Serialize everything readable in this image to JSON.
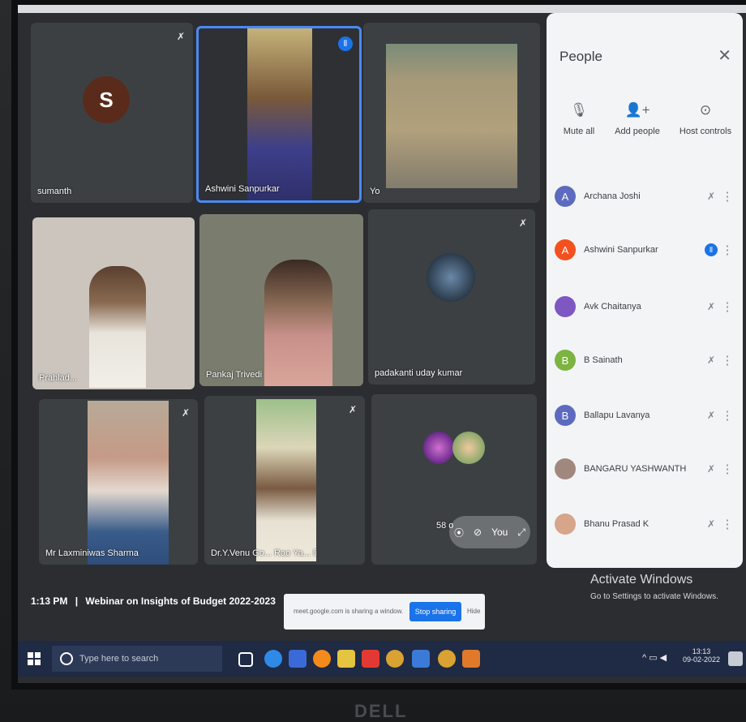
{
  "meeting": {
    "time": "1:13 PM",
    "title": "Webinar on Insights of Budget 2022-2023",
    "separator": "|"
  },
  "tiles": [
    {
      "name": "sumanth",
      "avatar_letter": "S"
    },
    {
      "name": "Ashwini Sanpurkar"
    },
    {
      "name": "Yo"
    },
    {
      "name": "Prahlad..."
    },
    {
      "name": "Pankaj Trivedi"
    },
    {
      "name": "padakanti uday kumar"
    },
    {
      "name": "Mr Laxminiwas Sharma"
    },
    {
      "name": "Dr.Y.Venu Go... Rao Ya... li"
    },
    {
      "name": "58 o"
    }
  ],
  "self_tile": {
    "you_label": "You"
  },
  "people_panel": {
    "title": "People",
    "close_glyph": "✕",
    "actions": [
      {
        "label": "Mute all",
        "icon": "mic-off-icon",
        "glyph": "🎙"
      },
      {
        "label": "Add people",
        "icon": "add-person-icon",
        "glyph": "👤+"
      },
      {
        "label": "Host controls",
        "icon": "toggle-icon",
        "glyph": "⊙"
      }
    ],
    "participants": [
      {
        "letter": "A",
        "name": "Archana Joshi",
        "color": "#5c6bc0",
        "status": "muted"
      },
      {
        "letter": "A",
        "name": "Ashwini Sanpurkar",
        "color": "#f4511e",
        "status": "speaking"
      },
      {
        "letter": "",
        "name": "Avk Chaitanya",
        "color": "#7e57c2",
        "status": "muted"
      },
      {
        "letter": "B",
        "name": "B Sainath",
        "color": "#7cb342",
        "status": "muted"
      },
      {
        "letter": "B",
        "name": "Ballapu Lavanya",
        "color": "#5c6bc0",
        "status": "muted"
      },
      {
        "letter": "",
        "name": "BANGARU YASHWANTH",
        "color": "#a1887f",
        "status": "muted"
      },
      {
        "letter": "",
        "name": "Bhanu Prasad K",
        "color": "#d7a58a",
        "status": "muted"
      }
    ]
  },
  "share_banner": {
    "message": "meet.google.com is sharing a window.",
    "stop_label": "Stop sharing",
    "hide_label": "Hide"
  },
  "watermark": {
    "line1": "Activate Windows",
    "line2": "Go to Settings to activate Windows."
  },
  "taskbar": {
    "search_placeholder": "Type here to search",
    "time": "13:13",
    "date": "09-02-2022"
  },
  "monitor_brand": "DELL",
  "colors": {
    "accent": "#1a73e8",
    "meet_bg": "#2b2d31",
    "tile_bg": "#3c4043",
    "taskbar": "#1f2a44"
  }
}
